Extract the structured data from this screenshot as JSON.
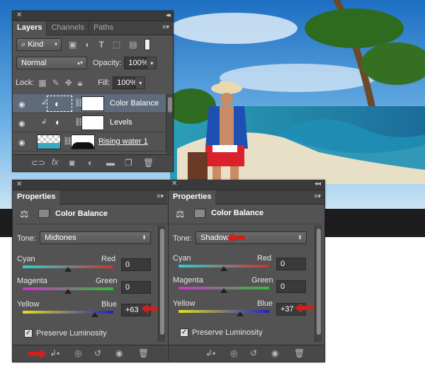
{
  "layers_panel": {
    "tabs": [
      "Layers",
      "Channels",
      "Paths"
    ],
    "filter_kind": "Kind",
    "blend_mode": "Normal",
    "opacity_label": "Opacity:",
    "opacity_value": "100%",
    "lock_label": "Lock:",
    "fill_label": "Fill:",
    "fill_value": "100%",
    "layers": [
      {
        "name": "Color Balance",
        "selected": true
      },
      {
        "name": "Levels",
        "selected": false
      },
      {
        "name": "Rising water 1",
        "selected": false
      }
    ],
    "footer_icons": [
      "link-icon",
      "fx-icon",
      "mask-icon",
      "adjustment-icon",
      "folder-icon",
      "new-layer-icon",
      "trash-icon"
    ]
  },
  "properties_left": {
    "tab": "Properties",
    "title": "Color Balance",
    "tone_label": "Tone:",
    "tone_value": "Midtones",
    "sliders": [
      {
        "left": "Cyan",
        "right": "Red",
        "value": "0",
        "pos": 0.5
      },
      {
        "left": "Magenta",
        "right": "Green",
        "value": "0",
        "pos": 0.5
      },
      {
        "left": "Yellow",
        "right": "Blue",
        "value": "+63",
        "pos": 0.8
      }
    ],
    "preserve_label": "Preserve Luminosity",
    "preserve_checked": true
  },
  "properties_right": {
    "tab": "Properties",
    "title": "Color Balance",
    "tone_label": "Tone:",
    "tone_value": "Shadows",
    "sliders": [
      {
        "left": "Cyan",
        "right": "Red",
        "value": "0",
        "pos": 0.5
      },
      {
        "left": "Magenta",
        "right": "Green",
        "value": "0",
        "pos": 0.5
      },
      {
        "left": "Yellow",
        "right": "Blue",
        "value": "+37",
        "pos": 0.68
      }
    ],
    "preserve_label": "Preserve Luminosity",
    "preserve_checked": true
  },
  "colors": {
    "accent_arrow": "#d0201c",
    "panel": "#535353",
    "selected_layer": "#5f6b7b"
  }
}
